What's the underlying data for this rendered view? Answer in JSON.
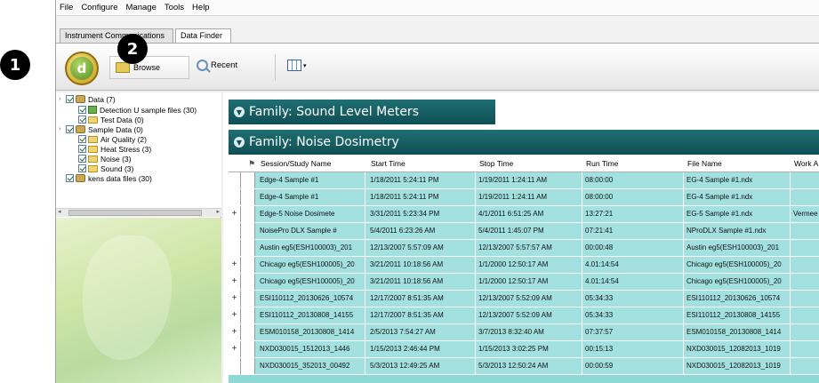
{
  "callouts": {
    "one": "1",
    "two": "2"
  },
  "menu": [
    "File",
    "Configure",
    "Manage",
    "Tools",
    "Help"
  ],
  "tabs": {
    "instrument": "Instrument Communications",
    "data_finder": "Data Finder"
  },
  "toolbar": {
    "logo_letter": "d",
    "browse": "Browse",
    "recent": "Recent",
    "grid_caret": "▾"
  },
  "tree": {
    "items": [
      {
        "label": "Data (7)",
        "expander": "›"
      },
      {
        "label": "Detection U sample files (30)",
        "expander": ""
      },
      {
        "label": "Test Data (0)",
        "expander": ""
      },
      {
        "label": "Sample Data (0)",
        "expander": "›"
      },
      {
        "label": "Air Quality (2)",
        "expander": ""
      },
      {
        "label": "Heat Stress (3)",
        "expander": ""
      },
      {
        "label": "Noise (3)",
        "expander": ""
      },
      {
        "label": "Sound (3)",
        "expander": ""
      },
      {
        "label": "kens data files (30)",
        "expander": ""
      }
    ],
    "scroll_left": "◂",
    "scroll_right": "▸"
  },
  "families": {
    "sound": "Family: Sound Level Meters",
    "noise": "Family: Noise Dosimetry"
  },
  "table": {
    "columns": [
      "Session/Study Name",
      "Start Time",
      "Stop Time",
      "Run Time",
      "File Name",
      "Work A"
    ],
    "rows": [
      {
        "exp": "",
        "name": "Edge-4 Sample #1",
        "start": "1/18/2011 5:24:11 PM",
        "stop": "1/19/2011 1:24:11 AM",
        "run": "08:00:00",
        "file": "EG-4 Sample #1.ndx",
        "work": ""
      },
      {
        "exp": "",
        "name": "Edge-4 Sample #1",
        "start": "1/18/2011 5:24:11 PM",
        "stop": "1/19/2011 1:24:11 AM",
        "run": "08:00:00",
        "file": "EG-4 Sample #1.ndx",
        "work": ""
      },
      {
        "exp": "+",
        "name": "Edge-5 Noise Dosimete",
        "start": "3/31/2011 5:23:34 PM",
        "stop": "4/1/2011 6:51:25 AM",
        "run": "13:27:21",
        "file": "EG-5 Sample #1.ndx",
        "work": "Vermee"
      },
      {
        "exp": "",
        "name": "NoisePro DLX Sample #",
        "start": "5/4/2011 6:23:26 AM",
        "stop": "5/4/2011 1:45:07 PM",
        "run": "07:21:41",
        "file": "NProDLX Sample #1.ndx",
        "work": ""
      },
      {
        "exp": "",
        "name": "Austin eg5(ESH100003)_201",
        "start": "12/13/2007 5:57:09 AM",
        "stop": "12/13/2007 5:57:57 AM",
        "run": "00:00:48",
        "file": "Austin eg5(ESH100003)_201",
        "work": ""
      },
      {
        "exp": "+",
        "name": "Chicago eg5(ESH100005)_20",
        "start": "3/21/2011 10:18:56 AM",
        "stop": "1/1/2000 12:50:17 AM",
        "run": "4.01:14:54",
        "file": "Chicago eg5(ESH100005)_20",
        "work": ""
      },
      {
        "exp": "+",
        "name": "Chicago eg5(ESH100005)_20",
        "start": "3/21/2011 10:18:56 AM",
        "stop": "1/1/2000 12:50:17 AM",
        "run": "4.01:14:54",
        "file": "Chicago eg5(ESH100005)_20",
        "work": ""
      },
      {
        "exp": "+",
        "name": "ESI110112_20130626_10574",
        "start": "12/17/2007 8:51:35 AM",
        "stop": "12/13/2007 5:52:09 AM",
        "run": "05:34:33",
        "file": "ESI110112_20130626_10574",
        "work": ""
      },
      {
        "exp": "+",
        "name": "ESI110112_20130808_14155",
        "start": "12/17/2007 8:51:35 AM",
        "stop": "12/13/2007 5:52:09 AM",
        "run": "05:34:33",
        "file": "ESI110112_20130808_14155",
        "work": ""
      },
      {
        "exp": "+",
        "name": "ESM010158_20130808_1414",
        "start": "2/5/2013 7:54:27 AM",
        "stop": "3/7/2013 8:32:40 AM",
        "run": "07:37:57",
        "file": "ESM010158_20130808_1414",
        "work": ""
      },
      {
        "exp": "+",
        "name": "NXD030015_1512013_1446",
        "start": "1/15/2013 2:46:44 PM",
        "stop": "1/15/2013 3:02:25 PM",
        "run": "00:15:13",
        "file": "NXD030015_12082013_1019",
        "work": ""
      },
      {
        "exp": "",
        "name": "NXD030015_352013_00492",
        "start": "5/3/2013 12:49:25 AM",
        "stop": "5/3/2013 12:50:24 AM",
        "run": "00:00:59",
        "file": "NXD030015_12082013_1019",
        "work": ""
      }
    ]
  }
}
